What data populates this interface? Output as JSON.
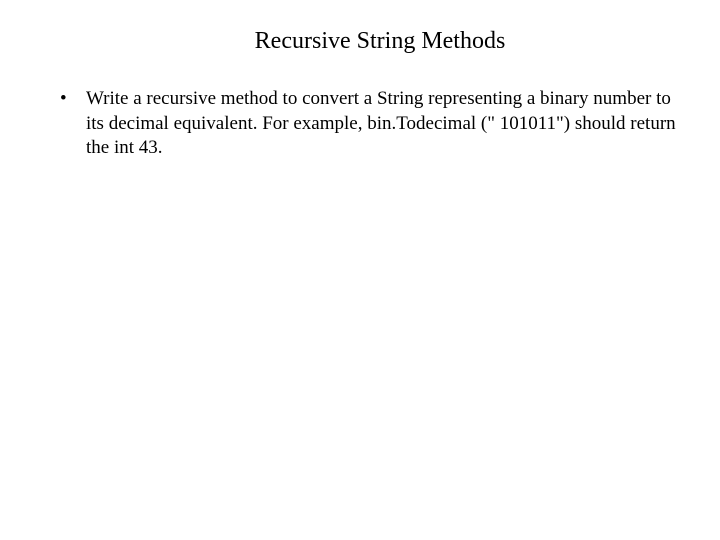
{
  "slide": {
    "title": "Recursive String Methods",
    "bullet": "Write a recursive method to convert a String representing a binary number to its decimal equivalent. For example, bin.Todecimal (\" 101011\") should return the int 43."
  }
}
